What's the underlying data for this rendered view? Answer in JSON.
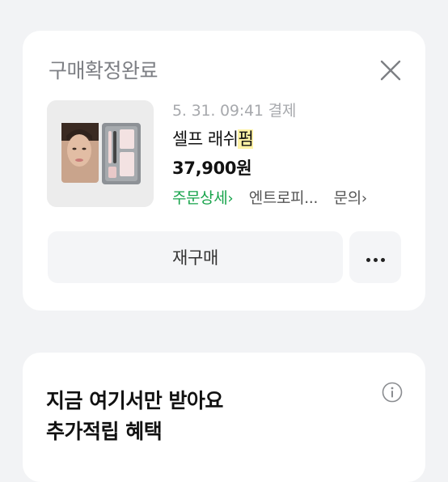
{
  "order": {
    "status_title": "구매확정완료",
    "date_text": "5. 31. 09:41 결제",
    "product_name_prefix": "셀프 래쉬",
    "product_name_highlight": "펌",
    "price": "37,900원",
    "detail_link": "주문상세",
    "seller_link": "엔트로피...",
    "inquiry_link": "문의",
    "rebuy_label": "재구매",
    "more_icon": "more-horizontal-icon",
    "close_icon": "close-icon"
  },
  "benefit": {
    "line1": "지금 여기서만 받아요",
    "line2": "추가적립 혜택",
    "info_icon": "info-icon"
  },
  "colors": {
    "background": "#f2f3f5",
    "card": "#ffffff",
    "accent_green": "#16a34a",
    "highlight_yellow": "#fff3a6",
    "button_bg": "#f4f5f7"
  }
}
